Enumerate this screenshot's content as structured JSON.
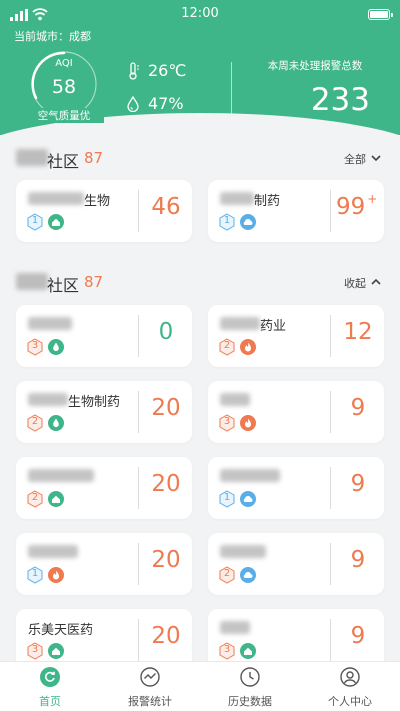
{
  "status_bar": {
    "time": "12:00"
  },
  "header": {
    "city_label": "当前城市：成都",
    "aqi": {
      "label": "AQI",
      "value": "58",
      "quality": "空气质量优"
    },
    "temperature": "26℃",
    "humidity": "47%",
    "alarm": {
      "label": "本周未处理报警总数",
      "total": "233"
    }
  },
  "colors": {
    "brand": "#3fb58a",
    "alert": "#ef7a4f",
    "info": "#5aaee8",
    "background": "#f2f3f5"
  },
  "sections": [
    {
      "name": "社区",
      "count": "87",
      "action": "全部",
      "cards": [
        {
          "name": "生物",
          "count": "46",
          "badges": [
            {
              "level": "1",
              "color": "#5aaee8"
            },
            {
              "icon": "home-icon",
              "color": "#3fb58a"
            }
          ]
        },
        {
          "name": "制药",
          "count": "99",
          "sup": "+",
          "badges": [
            {
              "level": "1",
              "color": "#5aaee8"
            },
            {
              "icon": "cloud-icon",
              "color": "#5aaee8"
            }
          ]
        }
      ]
    },
    {
      "name": "社区",
      "count": "87",
      "action": "收起",
      "cards": [
        {
          "name": "",
          "count": "0",
          "badges": [
            {
              "level": "3",
              "color": "#ef7a4f"
            },
            {
              "icon": "drop-icon",
              "color": "#3fb58a"
            }
          ]
        },
        {
          "name": "药业",
          "count": "12",
          "badges": [
            {
              "level": "2",
              "color": "#ef7a4f"
            },
            {
              "icon": "fire-icon",
              "color": "#ef7a4f"
            }
          ]
        },
        {
          "name": "生物制药",
          "count": "20",
          "badges": [
            {
              "level": "2",
              "color": "#ef7a4f"
            },
            {
              "icon": "drop-icon",
              "color": "#3fb58a"
            }
          ]
        },
        {
          "name": "",
          "count": "9",
          "badges": [
            {
              "level": "3",
              "color": "#ef7a4f"
            },
            {
              "icon": "fire-icon",
              "color": "#ef7a4f"
            }
          ]
        },
        {
          "name": "",
          "count": "20",
          "badges": [
            {
              "level": "2",
              "color": "#ef7a4f"
            },
            {
              "icon": "home-icon",
              "color": "#3fb58a"
            }
          ]
        },
        {
          "name": "",
          "count": "9",
          "badges": [
            {
              "level": "1",
              "color": "#5aaee8"
            },
            {
              "icon": "cloud-icon",
              "color": "#5aaee8"
            }
          ]
        },
        {
          "name": "",
          "count": "20",
          "badges": [
            {
              "level": "1",
              "color": "#5aaee8"
            },
            {
              "icon": "fire-icon",
              "color": "#ef7a4f"
            }
          ]
        },
        {
          "name": "",
          "count": "9",
          "badges": [
            {
              "level": "2",
              "color": "#ef7a4f"
            },
            {
              "icon": "cloud-icon",
              "color": "#5aaee8"
            }
          ]
        },
        {
          "name": "乐美天医药",
          "count": "20",
          "badges": [
            {
              "level": "3",
              "color": "#ef7a4f"
            },
            {
              "icon": "home-icon",
              "color": "#3fb58a"
            }
          ]
        },
        {
          "name": "",
          "count": "9",
          "badges": [
            {
              "level": "3",
              "color": "#ef7a4f"
            },
            {
              "icon": "home-icon",
              "color": "#3fb58a"
            }
          ]
        }
      ]
    }
  ],
  "bottom_nav": [
    {
      "label": "首页",
      "icon": "home-refresh-icon",
      "active": true
    },
    {
      "label": "报警统计",
      "icon": "chart-icon",
      "active": false
    },
    {
      "label": "历史数据",
      "icon": "clock-icon",
      "active": false
    },
    {
      "label": "个人中心",
      "icon": "user-icon",
      "active": false
    }
  ]
}
